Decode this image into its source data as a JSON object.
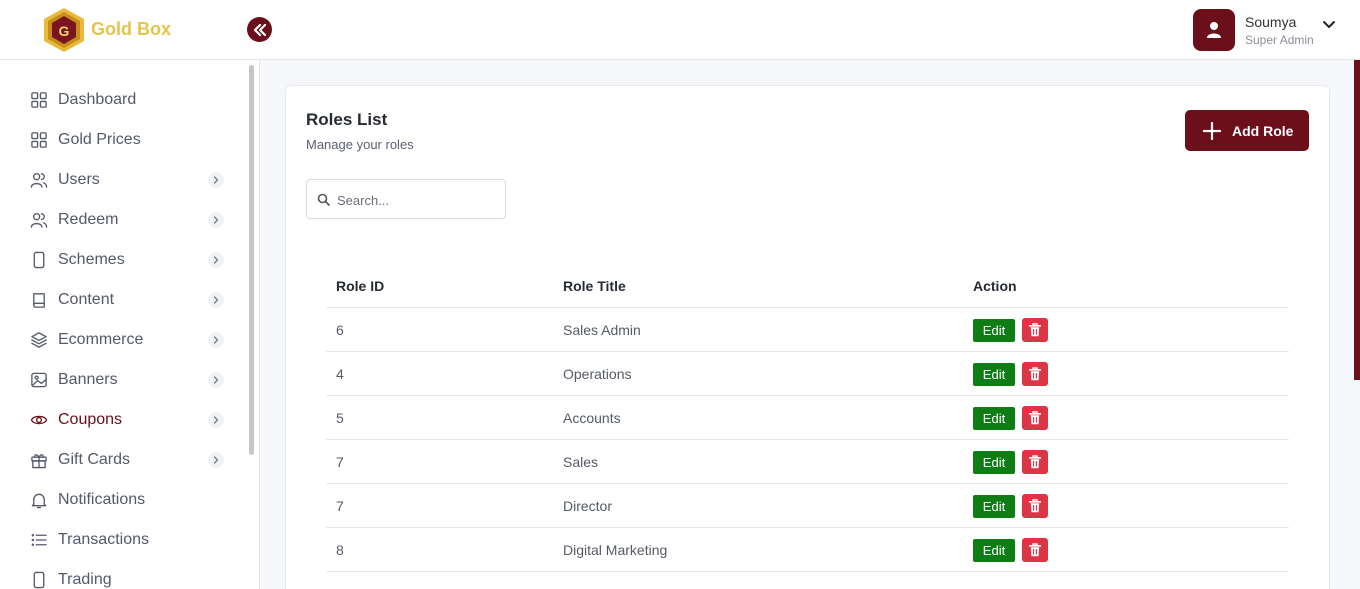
{
  "brand": {
    "name": "Gold Box"
  },
  "user": {
    "name": "Soumya",
    "role": "Super Admin"
  },
  "sidebar": {
    "items": [
      {
        "label": "Dashboard",
        "icon": "grid-icon",
        "submenu": false,
        "active": false
      },
      {
        "label": "Gold Prices",
        "icon": "grid-icon",
        "submenu": false,
        "active": false
      },
      {
        "label": "Users",
        "icon": "users-icon",
        "submenu": true,
        "active": false
      },
      {
        "label": "Redeem",
        "icon": "users-icon",
        "submenu": true,
        "active": false
      },
      {
        "label": "Schemes",
        "icon": "phone-icon",
        "submenu": true,
        "active": false
      },
      {
        "label": "Content",
        "icon": "book-icon",
        "submenu": true,
        "active": false
      },
      {
        "label": "Ecommerce",
        "icon": "layers-icon",
        "submenu": true,
        "active": false
      },
      {
        "label": "Banners",
        "icon": "image-icon",
        "submenu": true,
        "active": false
      },
      {
        "label": "Coupons",
        "icon": "eye-icon",
        "submenu": true,
        "active": true
      },
      {
        "label": "Gift Cards",
        "icon": "gift-icon",
        "submenu": true,
        "active": false
      },
      {
        "label": "Notifications",
        "icon": "bell-icon",
        "submenu": false,
        "active": false
      },
      {
        "label": "Transactions",
        "icon": "list-icon",
        "submenu": false,
        "active": false
      },
      {
        "label": "Trading",
        "icon": "phone-icon",
        "submenu": false,
        "active": false
      }
    ]
  },
  "main": {
    "title": "Roles List",
    "subtitle": "Manage your roles",
    "add_button_label": "Add Role",
    "search": {
      "placeholder": "Search...",
      "value": ""
    },
    "table": {
      "headers": [
        "Role ID",
        "Role Title",
        "Action"
      ],
      "edit_label": "Edit",
      "rows": [
        {
          "id": "6",
          "title": "Sales Admin"
        },
        {
          "id": "4",
          "title": "Operations"
        },
        {
          "id": "5",
          "title": "Accounts"
        },
        {
          "id": "7",
          "title": "Sales"
        },
        {
          "id": "7",
          "title": "Director"
        },
        {
          "id": "8",
          "title": "Digital Marketing"
        }
      ]
    }
  },
  "colors": {
    "brand_maroon": "#6b0f1a",
    "brand_gold": "#e6c44c",
    "edit_green": "#0f7d16",
    "delete_red": "#dc3545"
  }
}
